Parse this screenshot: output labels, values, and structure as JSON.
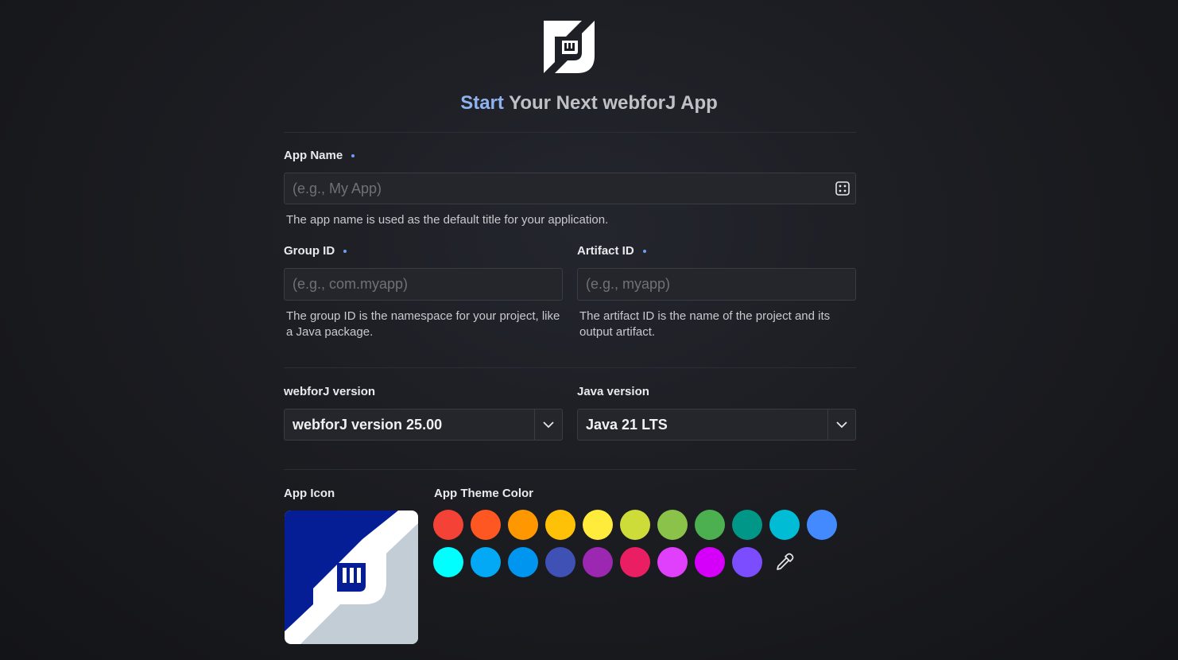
{
  "header": {
    "title_accent": "Start",
    "title_rest": " Your Next webforJ App",
    "logo_icon": "webforj-logo-icon"
  },
  "form": {
    "app_name": {
      "label": "App Name",
      "placeholder": "(e.g., My App)",
      "value": "",
      "help": "The app name is used as the default title for your application.",
      "action_icon": "dice-random-icon"
    },
    "group_id": {
      "label": "Group ID",
      "placeholder": "(e.g., com.myapp)",
      "value": "",
      "help": "The group ID is the namespace for your project, like a Java package."
    },
    "artifact_id": {
      "label": "Artifact ID",
      "placeholder": "(e.g., myapp)",
      "value": "",
      "help": "The artifact ID is the name of the project and its output artifact."
    },
    "webforj_version": {
      "label": "webforJ version",
      "selected": "webforJ version 25.00"
    },
    "java_version": {
      "label": "Java version",
      "selected": "Java 21 LTS"
    },
    "app_icon": {
      "label": "App Icon",
      "icon": "webforj-app-icon"
    },
    "theme_color": {
      "label": "App Theme Color",
      "picker_icon": "eyedropper-icon",
      "swatches": [
        "#f44336",
        "#ff5722",
        "#ff9800",
        "#ffc107",
        "#ffeb3b",
        "#cddc39",
        "#8bc34a",
        "#4caf50",
        "#009688",
        "#00bcd4",
        "#448aff",
        "#00ffff",
        "#03a9f4",
        "#0096f0",
        "#3f51b5",
        "#9c27b0",
        "#e91e63",
        "#e040fb",
        "#d500f9",
        "#7c4dff"
      ]
    }
  },
  "colors": {
    "accent": "#8fb3ef",
    "required_dot": "#6fa0ef",
    "field_bg": "#25262b",
    "field_border": "#3a3c43",
    "icon_primary": "#051e96",
    "icon_secondary": "#c2cdd6"
  }
}
